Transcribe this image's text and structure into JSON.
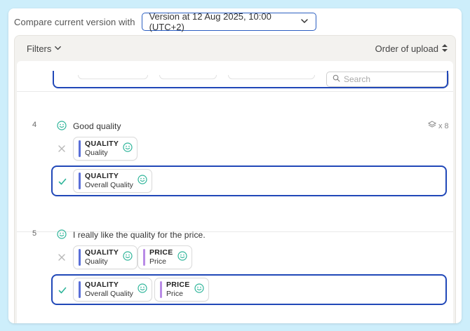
{
  "compare": {
    "label": "Compare current version with",
    "version": "Version at 12 Aug 2025, 10:00 (UTC+2)"
  },
  "toolbar": {
    "filters_label": "Filters",
    "order_label": "Order of upload"
  },
  "search": {
    "placeholder": "Search"
  },
  "rows": [
    {
      "number": "4",
      "text": "Good quality",
      "layer_count": "x 8",
      "rejected_tags": [
        {
          "category": "QUALITY",
          "label": "Quality",
          "color": "#5a6fd8"
        }
      ],
      "accepted_tags": [
        {
          "category": "QUALITY",
          "label": "Overall Quality",
          "color": "#5a6fd8"
        }
      ]
    },
    {
      "number": "5",
      "text": "I really like the quality for the price.",
      "rejected_tags": [
        {
          "category": "QUALITY",
          "label": "Quality",
          "color": "#5a6fd8"
        },
        {
          "category": "PRICE",
          "label": "Price",
          "color": "#b98be6"
        }
      ],
      "accepted_tags": [
        {
          "category": "QUALITY",
          "label": "Overall Quality",
          "color": "#5a6fd8"
        },
        {
          "category": "PRICE",
          "label": "Price",
          "color": "#b98be6"
        }
      ]
    }
  ],
  "colors": {
    "accent_blue": "#2148b8",
    "sentiment_green": "#2fb59a",
    "reject_gray": "#b8b8b8",
    "accept_green": "#2fb59a"
  }
}
